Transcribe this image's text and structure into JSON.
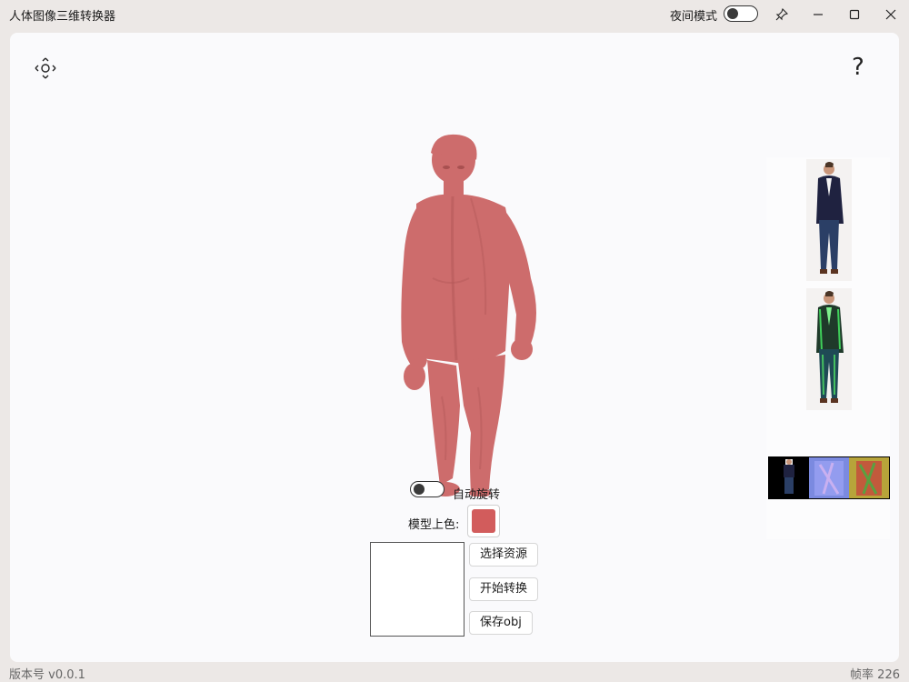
{
  "window": {
    "title": "人体图像三维转换器",
    "night_mode_label": "夜间模式"
  },
  "toolbar": {
    "help_label": "?"
  },
  "controls": {
    "auto_rotate_label": "自动旋转",
    "model_color_label": "模型上色:",
    "model_color": "#d25c5c",
    "select_button": "选择资源",
    "start_button": "开始转换",
    "save_button": "保存obj"
  },
  "colors": {
    "model": "#cd6c6c",
    "model_shade": "#b55a5a",
    "window_bg": "#ece8e6",
    "panel_bg": "#fafafc"
  },
  "thumbnails": [
    {
      "name": "original-photo"
    },
    {
      "name": "segmentation-photo"
    },
    {
      "name": "normal-map-strip"
    }
  ],
  "footer": {
    "version": "版本号 v0.0.1",
    "fps": "帧率 226"
  }
}
